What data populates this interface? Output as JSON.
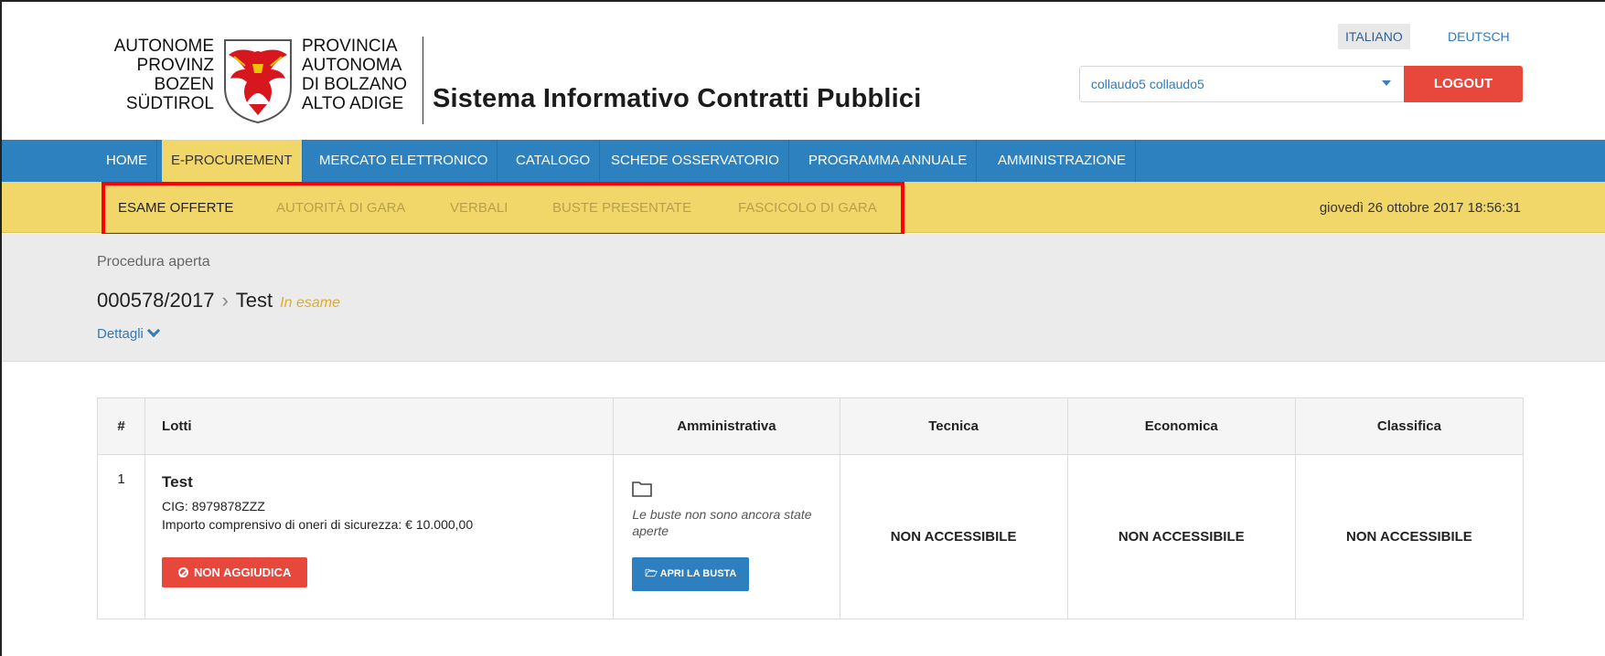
{
  "logo": {
    "left_lines": [
      "AUTONOME",
      "PROVINZ",
      "BOZEN",
      "SÜDTIROL"
    ],
    "right_lines": [
      "PROVINCIA",
      "AUTONOMA",
      "DI BOLZANO",
      "ALTO ADIGE"
    ]
  },
  "header": {
    "title": "Sistema Informativo Contratti Pubblici",
    "lang_it": "ITALIANO",
    "lang_de": "DEUTSCH",
    "user": "collaudo5 collaudo5",
    "logout": "LOGOUT"
  },
  "nav": {
    "items": [
      "HOME",
      "E-PROCUREMENT",
      "MERCATO ELETTRONICO",
      "CATALOGO",
      "SCHEDE OSSERVATORIO",
      "PROGRAMMA ANNUALE",
      "AMMINISTRAZIONE"
    ],
    "active": "E-PROCUREMENT"
  },
  "subnav": {
    "items": [
      "ESAME OFFERTE",
      "AUTORITÀ DI GARA",
      "VERBALI",
      "BUSTE PRESENTATE",
      "FASCICOLO DI GARA"
    ],
    "active": "ESAME OFFERTE",
    "datetime": "giovedì 26 ottobre 2017 18:56:31"
  },
  "procedure": {
    "type": "Procedura aperta",
    "code": "000578/2017",
    "name": "Test",
    "status": "In esame",
    "details_label": "Dettagli"
  },
  "table": {
    "headers": [
      "#",
      "Lotti",
      "Amministrativa",
      "Tecnica",
      "Economica",
      "Classifica"
    ],
    "row": {
      "num": "1",
      "lot_title": "Test",
      "cig": "CIG: 8979878ZZZ",
      "amount": "Importo comprensivo di oneri di sicurezza: € 10.000,00",
      "btn_not_award": "NON AGGIUDICA",
      "amm_note": "Le buste non sono ancora state aperte",
      "btn_open": "APRI LA BUSTA",
      "tecnica": "NON ACCESSIBILE",
      "economica": "NON ACCESSIBILE",
      "classifica": "NON ACCESSIBILE"
    }
  },
  "colors": {
    "nav_blue": "#2d81bf",
    "sub_yellow": "#f1d76a",
    "logout_red": "#e8473c",
    "highlight_red": "#ff0000",
    "status_orange": "#e0ac27"
  }
}
